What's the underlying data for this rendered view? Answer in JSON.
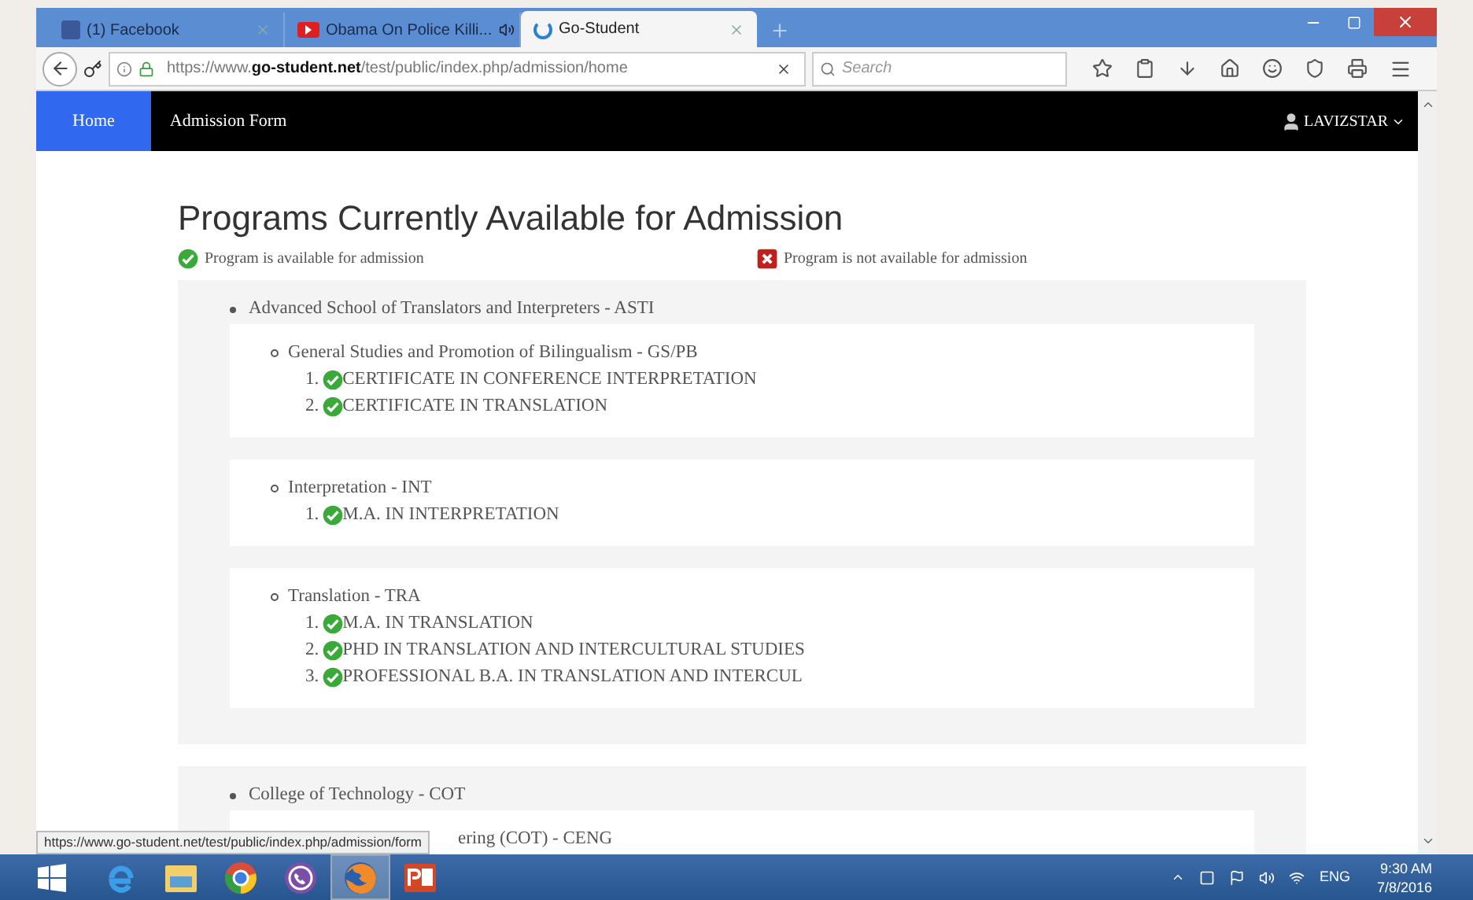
{
  "browser": {
    "tabs": [
      {
        "title": "(1) Facebook",
        "kind": "square",
        "audio": false,
        "selected": false
      },
      {
        "title": "Obama On Police Killi...",
        "kind": "video",
        "audio": true,
        "selected": false
      },
      {
        "title": "Go-Student",
        "kind": "loading",
        "audio": false,
        "selected": true
      }
    ],
    "url": "https://www.**go-student.net**/test/public/index.php/admission/home",
    "search": {
      "placeholder": "Search"
    }
  },
  "navbar": {
    "items": [
      {
        "label": "Home",
        "selected": true
      },
      {
        "label": "Admission Form",
        "selected": false
      }
    ],
    "user": "LAVIZSTAR"
  },
  "page": {
    "title": "Programs Currently Available for Admission",
    "legend": [
      {
        "kind": "available",
        "label": "Program is available for admission"
      },
      {
        "kind": "unavailable",
        "label": "Program is not available for admission"
      }
    ],
    "schools": [
      {
        "name": "Advanced School of Translators and Interpreters - ASTI",
        "departments": [
          {
            "name": "General Studies and Promotion of Bilingualism - GS/PB",
            "programs": [
              {
                "number": "1.",
                "name": "CERTIFICATE IN CONFERENCE INTERPRETATION",
                "available": true
              },
              {
                "number": "2.",
                "name": "CERTIFICATE IN TRANSLATION",
                "available": true
              }
            ]
          },
          {
            "name": "Interpretation - INT",
            "programs": [
              {
                "number": "1.",
                "name": "M.A. IN INTERPRETATION",
                "available": true
              }
            ]
          },
          {
            "name": "Translation - TRA",
            "programs": [
              {
                "number": "1.",
                "name": "M.A. IN TRANSLATION",
                "available": true
              },
              {
                "number": "2.",
                "name": "PHD IN TRANSLATION AND INTERCULTURAL STUDIES",
                "available": true
              },
              {
                "number": "3.",
                "name": "PROFESSIONAL B.A. IN TRANSLATION AND INTERCUL",
                "available": true
              }
            ]
          }
        ]
      },
      {
        "name": "College of Technology - COT",
        "departments": [
          {
            "name": "ering (COT) - CENG",
            "partial": true
          }
        ]
      }
    ]
  },
  "status_url": "https://www.go-student.net/test/public/index.php/admission/form",
  "taskbar": {
    "apps": [
      {
        "kind": "browser-e",
        "selected": false
      },
      {
        "kind": "folder",
        "selected": false
      },
      {
        "kind": "ring",
        "selected": false
      },
      {
        "kind": "phone",
        "selected": false
      },
      {
        "kind": "fox",
        "selected": true
      },
      {
        "kind": "slides",
        "selected": false
      }
    ],
    "language": "ENG",
    "time": "9:30 AM",
    "date": "7/8/2016"
  }
}
